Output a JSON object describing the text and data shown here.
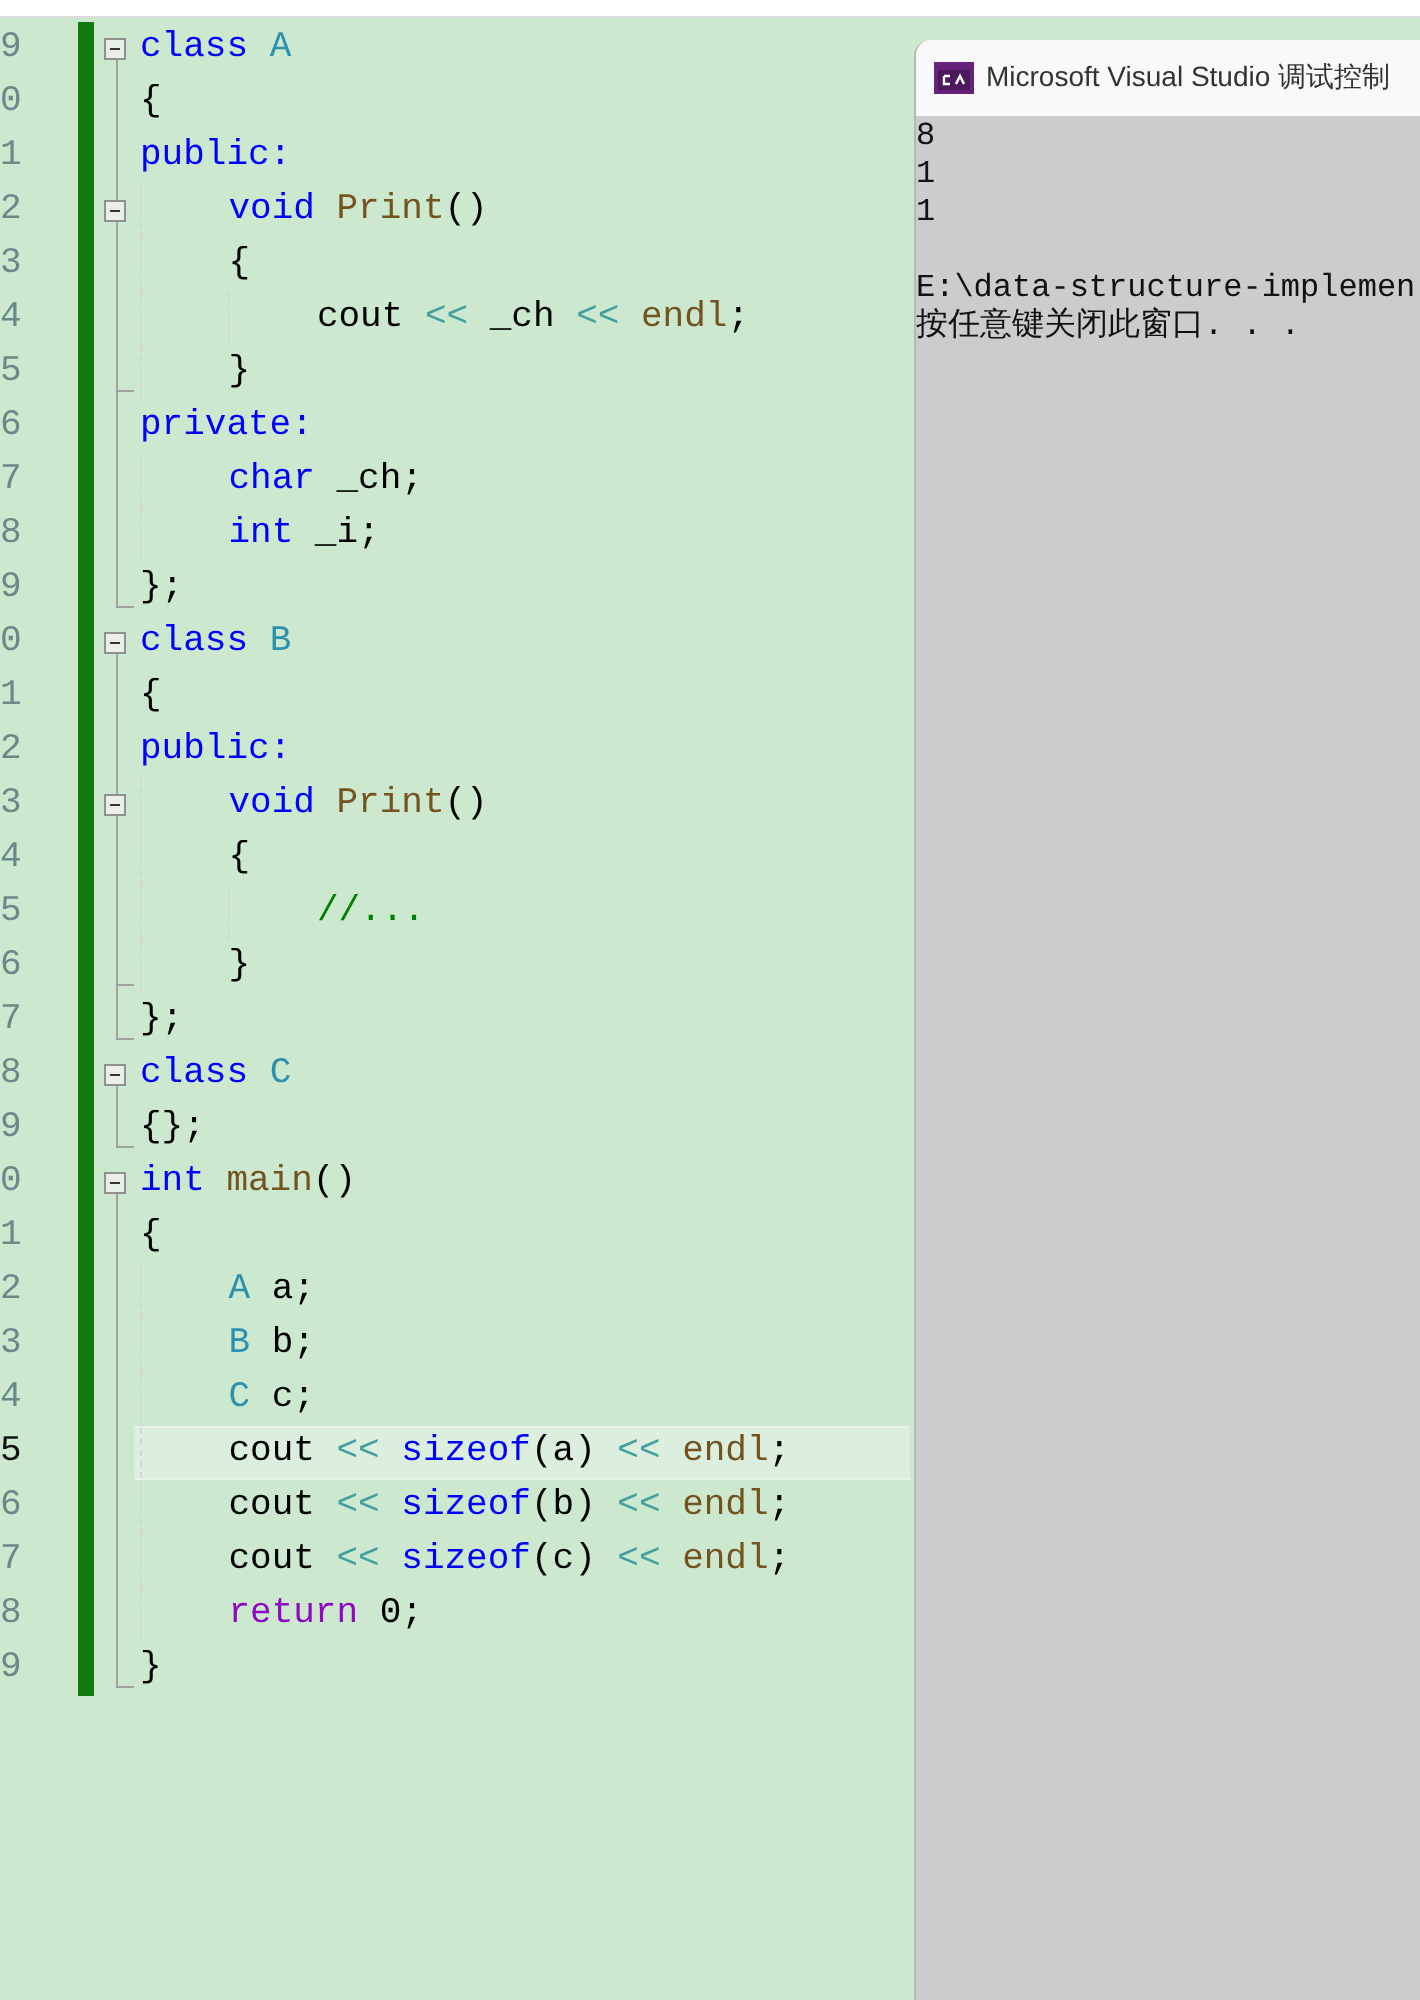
{
  "editor": {
    "lines": [
      {
        "number": "9",
        "fold_start": true,
        "fold_end": false,
        "current": false,
        "tokens": [
          {
            "text": "class",
            "kind": "keyword"
          },
          {
            "text": " A",
            "kind": "type"
          }
        ]
      },
      {
        "number": "0",
        "fold_start": false,
        "fold_end": false,
        "current": false,
        "tokens": [
          {
            "text": "{",
            "kind": "plain"
          }
        ]
      },
      {
        "number": "1",
        "fold_start": false,
        "fold_end": false,
        "current": false,
        "tokens": [
          {
            "text": "public:",
            "kind": "keyword"
          }
        ]
      },
      {
        "number": "2",
        "fold_start": true,
        "fold_end": false,
        "current": false,
        "tokens": [
          {
            "text": "    void",
            "kind": "keyword"
          },
          {
            "text": " Print",
            "kind": "func"
          },
          {
            "text": "()",
            "kind": "plain"
          }
        ]
      },
      {
        "number": "3",
        "fold_start": false,
        "fold_end": false,
        "current": false,
        "tokens": [
          {
            "text": "    {",
            "kind": "plain"
          }
        ]
      },
      {
        "number": "4",
        "fold_start": false,
        "fold_end": false,
        "current": false,
        "tokens": [
          {
            "text": "        cout",
            "kind": "plain"
          },
          {
            "text": " <<",
            "kind": "op"
          },
          {
            "text": " _ch",
            "kind": "plain"
          },
          {
            "text": " <<",
            "kind": "op"
          },
          {
            "text": " endl",
            "kind": "func"
          },
          {
            "text": ";",
            "kind": "plain"
          }
        ]
      },
      {
        "number": "5",
        "fold_start": false,
        "fold_end": true,
        "current": false,
        "tokens": [
          {
            "text": "    }",
            "kind": "plain"
          }
        ]
      },
      {
        "number": "6",
        "fold_start": false,
        "fold_end": false,
        "current": false,
        "tokens": [
          {
            "text": "private:",
            "kind": "keyword"
          }
        ]
      },
      {
        "number": "7",
        "fold_start": false,
        "fold_end": false,
        "current": false,
        "tokens": [
          {
            "text": "    char",
            "kind": "keyword"
          },
          {
            "text": " _ch;",
            "kind": "plain"
          }
        ]
      },
      {
        "number": "8",
        "fold_start": false,
        "fold_end": false,
        "current": false,
        "tokens": [
          {
            "text": "    int",
            "kind": "keyword"
          },
          {
            "text": " _i;",
            "kind": "plain"
          }
        ]
      },
      {
        "number": "9",
        "fold_start": false,
        "fold_end": true,
        "current": false,
        "tokens": [
          {
            "text": "};",
            "kind": "plain"
          }
        ]
      },
      {
        "number": "0",
        "fold_start": true,
        "fold_end": false,
        "current": false,
        "tokens": [
          {
            "text": "class",
            "kind": "keyword"
          },
          {
            "text": " B",
            "kind": "type"
          }
        ]
      },
      {
        "number": "1",
        "fold_start": false,
        "fold_end": false,
        "current": false,
        "tokens": [
          {
            "text": "{",
            "kind": "plain"
          }
        ]
      },
      {
        "number": "2",
        "fold_start": false,
        "fold_end": false,
        "current": false,
        "tokens": [
          {
            "text": "public:",
            "kind": "keyword"
          }
        ]
      },
      {
        "number": "3",
        "fold_start": true,
        "fold_end": false,
        "current": false,
        "tokens": [
          {
            "text": "    void",
            "kind": "keyword"
          },
          {
            "text": " Print",
            "kind": "func"
          },
          {
            "text": "()",
            "kind": "plain"
          }
        ]
      },
      {
        "number": "4",
        "fold_start": false,
        "fold_end": false,
        "current": false,
        "tokens": [
          {
            "text": "    {",
            "kind": "plain"
          }
        ]
      },
      {
        "number": "5",
        "fold_start": false,
        "fold_end": false,
        "current": false,
        "tokens": [
          {
            "text": "        //...",
            "kind": "comment"
          }
        ]
      },
      {
        "number": "6",
        "fold_start": false,
        "fold_end": true,
        "current": false,
        "tokens": [
          {
            "text": "    }",
            "kind": "plain"
          }
        ]
      },
      {
        "number": "7",
        "fold_start": false,
        "fold_end": true,
        "current": false,
        "tokens": [
          {
            "text": "};",
            "kind": "plain"
          }
        ]
      },
      {
        "number": "8",
        "fold_start": true,
        "fold_end": false,
        "current": false,
        "tokens": [
          {
            "text": "class",
            "kind": "keyword"
          },
          {
            "text": " C",
            "kind": "type"
          }
        ]
      },
      {
        "number": "9",
        "fold_start": false,
        "fold_end": true,
        "current": false,
        "tokens": [
          {
            "text": "{};",
            "kind": "plain"
          }
        ]
      },
      {
        "number": "0",
        "fold_start": true,
        "fold_end": false,
        "current": false,
        "tokens": [
          {
            "text": "int",
            "kind": "keyword"
          },
          {
            "text": " main",
            "kind": "func"
          },
          {
            "text": "()",
            "kind": "plain"
          }
        ]
      },
      {
        "number": "1",
        "fold_start": false,
        "fold_end": false,
        "current": false,
        "tokens": [
          {
            "text": "{",
            "kind": "plain"
          }
        ]
      },
      {
        "number": "2",
        "fold_start": false,
        "fold_end": false,
        "current": false,
        "tokens": [
          {
            "text": "    A",
            "kind": "type"
          },
          {
            "text": " a;",
            "kind": "plain"
          }
        ]
      },
      {
        "number": "3",
        "fold_start": false,
        "fold_end": false,
        "current": false,
        "tokens": [
          {
            "text": "    B",
            "kind": "type"
          },
          {
            "text": " b;",
            "kind": "plain"
          }
        ]
      },
      {
        "number": "4",
        "fold_start": false,
        "fold_end": false,
        "current": false,
        "tokens": [
          {
            "text": "    C",
            "kind": "type"
          },
          {
            "text": " c;",
            "kind": "plain"
          }
        ]
      },
      {
        "number": "5",
        "fold_start": false,
        "fold_end": false,
        "current": true,
        "tokens": [
          {
            "text": "    cout",
            "kind": "plain"
          },
          {
            "text": " <<",
            "kind": "op"
          },
          {
            "text": " sizeof",
            "kind": "keyword"
          },
          {
            "text": "(a)",
            "kind": "plain"
          },
          {
            "text": " <<",
            "kind": "op"
          },
          {
            "text": " endl",
            "kind": "func"
          },
          {
            "text": ";",
            "kind": "plain"
          }
        ]
      },
      {
        "number": "6",
        "fold_start": false,
        "fold_end": false,
        "current": false,
        "tokens": [
          {
            "text": "    cout",
            "kind": "plain"
          },
          {
            "text": " <<",
            "kind": "op"
          },
          {
            "text": " sizeof",
            "kind": "keyword"
          },
          {
            "text": "(b)",
            "kind": "plain"
          },
          {
            "text": " <<",
            "kind": "op"
          },
          {
            "text": " endl",
            "kind": "func"
          },
          {
            "text": ";",
            "kind": "plain"
          }
        ]
      },
      {
        "number": "7",
        "fold_start": false,
        "fold_end": false,
        "current": false,
        "tokens": [
          {
            "text": "    cout",
            "kind": "plain"
          },
          {
            "text": " <<",
            "kind": "op"
          },
          {
            "text": " sizeof",
            "kind": "keyword"
          },
          {
            "text": "(c)",
            "kind": "plain"
          },
          {
            "text": " <<",
            "kind": "op"
          },
          {
            "text": " endl",
            "kind": "func"
          },
          {
            "text": ";",
            "kind": "plain"
          }
        ]
      },
      {
        "number": "8",
        "fold_start": false,
        "fold_end": false,
        "current": false,
        "tokens": [
          {
            "text": "    return",
            "kind": "control"
          },
          {
            "text": " 0;",
            "kind": "plain"
          }
        ]
      },
      {
        "number": "9",
        "fold_start": false,
        "fold_end": true,
        "current": false,
        "tokens": [
          {
            "text": "}",
            "kind": "plain"
          }
        ]
      }
    ]
  },
  "console": {
    "title": "Microsoft Visual Studio 调试控制",
    "output": [
      "8",
      "1",
      "1",
      "E:\\data-structure-implemen",
      "按任意键关闭此窗口. . ."
    ]
  }
}
